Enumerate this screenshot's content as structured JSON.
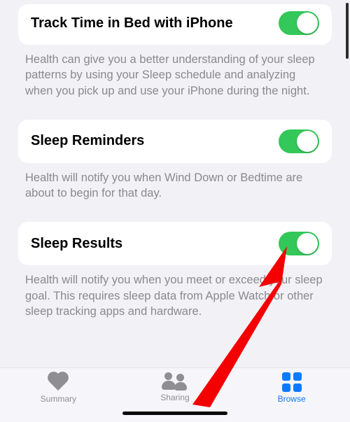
{
  "sections": {
    "trackBed": {
      "title": "Track Time in Bed with iPhone",
      "description": "Health can give you a better understanding of your sleep patterns by using your Sleep schedule and analyzing when you pick up and use your iPhone during the night.",
      "enabled": true
    },
    "reminders": {
      "title": "Sleep Reminders",
      "description": "Health will notify you when Wind Down or Bedtime are about to begin for that day.",
      "enabled": true
    },
    "results": {
      "title": "Sleep Results",
      "description": "Health will notify you when you meet or exceed your sleep goal. This requires sleep data from Apple Watch or other sleep tracking apps and hardware.",
      "enabled": true
    }
  },
  "tabs": {
    "summary": "Summary",
    "sharing": "Sharing",
    "browse": "Browse"
  },
  "colors": {
    "toggleOn": "#34c759",
    "accent": "#0a7aff",
    "arrow": "#f40000"
  }
}
